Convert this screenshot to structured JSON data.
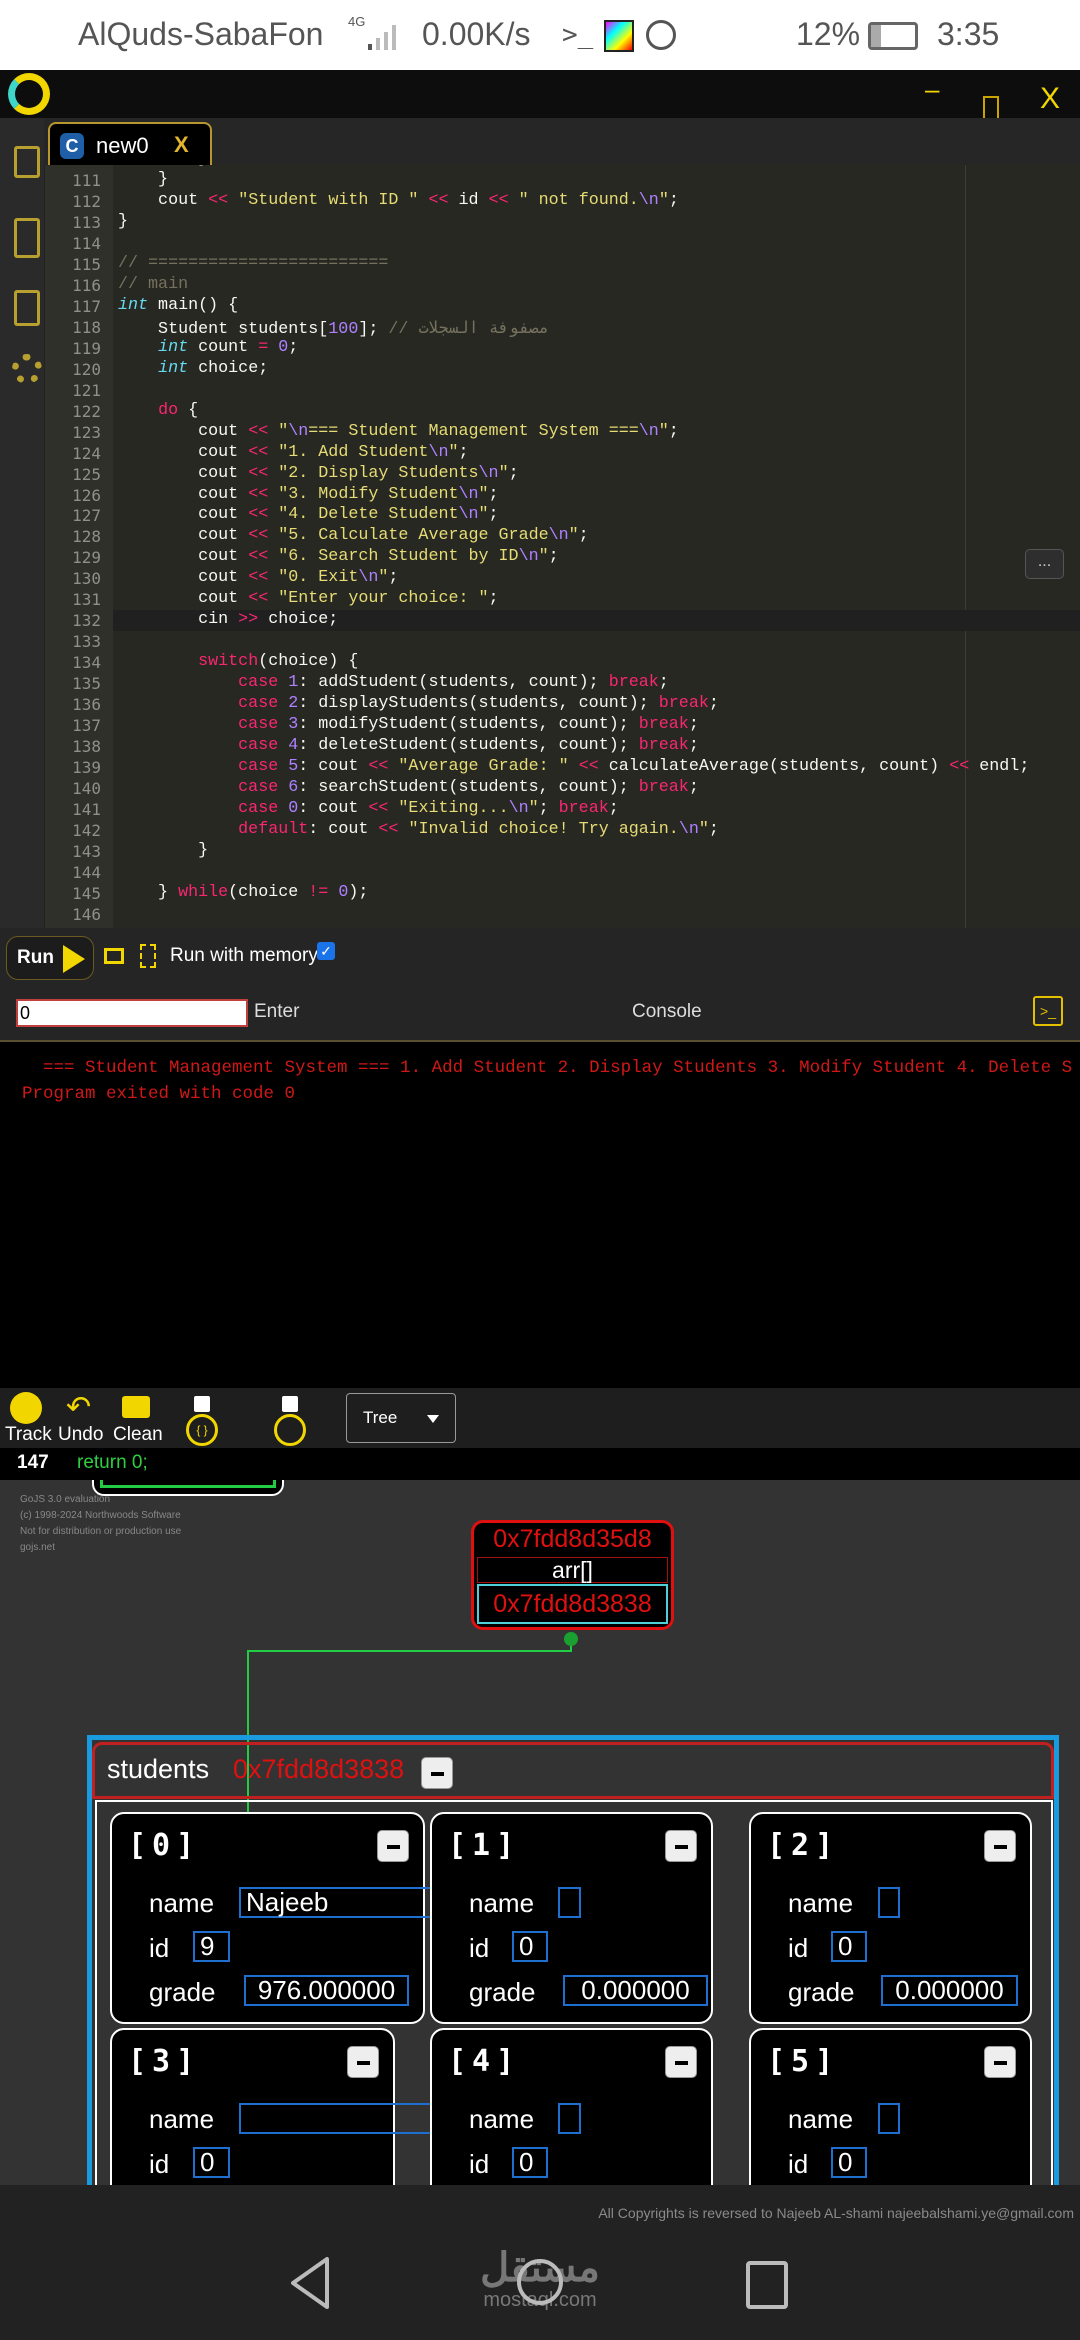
{
  "status_bar": {
    "carrier": "AlQuds-SabaFon",
    "network": "4G",
    "speed": "0.00K/s",
    "battery": "12%",
    "time": "3:35"
  },
  "window": {
    "minimize": "–",
    "maximize": "☐",
    "close": "X"
  },
  "tab": {
    "label": "new0",
    "close": "X"
  },
  "editor": {
    "first_line": 110,
    "active_line": 132,
    "lines": [
      "        }",
      "    }",
      "    cout << \"Student with ID \" << id << \" not found.\\n\";",
      "}",
      "",
      "// ========================",
      "// main",
      "int main() {",
      "    Student students[100]; // مصفوفة السجلات",
      "    int count = 0;",
      "    int choice;",
      "",
      "    do {",
      "        cout << \"\\n=== Student Management System ===\\n\";",
      "        cout << \"1. Add Student\\n\";",
      "        cout << \"2. Display Students\\n\";",
      "        cout << \"3. Modify Student\\n\";",
      "        cout << \"4. Delete Student\\n\";",
      "        cout << \"5. Calculate Average Grade\\n\";",
      "        cout << \"6. Search Student by ID\\n\";",
      "        cout << \"0. Exit\\n\";",
      "        cout << \"Enter your choice: \";",
      "        cin >> choice;",
      "",
      "        switch(choice) {",
      "            case 1: addStudent(students, count); break;",
      "            case 2: displayStudents(students, count); break;",
      "            case 3: modifyStudent(students, count); break;",
      "            case 4: deleteStudent(students, count); break;",
      "            case 5: cout << \"Average Grade: \" << calculateAverage(students, count) << endl;",
      "            case 6: searchStudent(students, count); break;",
      "            case 0: cout << \"Exiting...\\n\"; break;",
      "            default: cout << \"Invalid choice! Try again.\\n\";",
      "        }",
      "",
      "    } while(choice != 0);",
      ""
    ],
    "more_button": "..."
  },
  "run_bar": {
    "run": "Run",
    "run_with_memory": "Run with memory",
    "memory_checked": true
  },
  "console": {
    "input_value": "0",
    "enter": "Enter",
    "title": "Console",
    "output": [
      "  === Student Management System === 1. Add Student 2. Display Students 3. Modify Student 4. Delete S",
      "Program exited with code 0"
    ]
  },
  "track_bar": {
    "track": "Track",
    "undo": "Undo",
    "clean": "Clean",
    "view_select": "Tree"
  },
  "current_line": {
    "number": "147",
    "code": "return 0;"
  },
  "diagram": {
    "watermark": [
      "GoJS 3.0 evaluation",
      "(c) 1998-2024 Northwoods Software",
      "Not for distribution or production use",
      "gojs.net"
    ],
    "arr_node": {
      "address": "0x7fdd8d35d8",
      "name": "arr[]",
      "value": "0x7fdd8d3838"
    },
    "array": {
      "name": "students",
      "address": "0x7fdd8d3838",
      "elements": [
        {
          "index": "[0]",
          "name": "Najeeb",
          "id": "9",
          "grade": "976.000000"
        },
        {
          "index": "[1]",
          "name": "",
          "id": "0",
          "grade": "0.000000"
        },
        {
          "index": "[2]",
          "name": "",
          "id": "0",
          "grade": "0.000000"
        },
        {
          "index": "[3]",
          "name": "",
          "id": "0"
        },
        {
          "index": "[4]",
          "name": "",
          "id": "0"
        },
        {
          "index": "[5]",
          "name": "",
          "id": "0"
        }
      ],
      "labels": {
        "name": "name",
        "id": "id",
        "grade": "grade"
      }
    }
  },
  "footer": {
    "copyright": "All Copyrights is reversed to Najeeb AL-shami najeebalshami.ye@gmail.com",
    "watermark_ar": "مستقل",
    "watermark_en": "mostaql.com"
  },
  "colors": {
    "accent": "#f2d600",
    "address": "#e01010",
    "link": "#22cc44",
    "value_border": "#1e6fd0"
  }
}
